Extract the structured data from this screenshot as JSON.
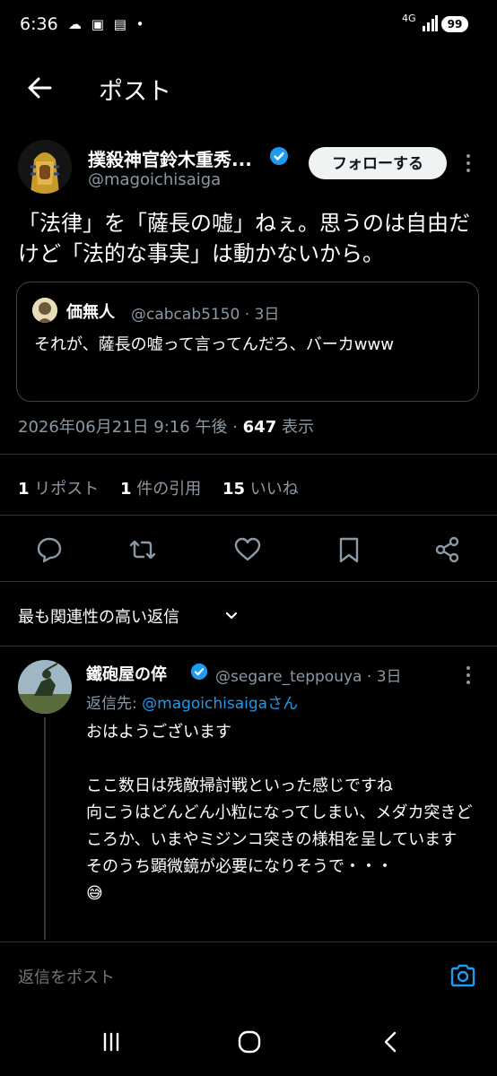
{
  "status_bar": {
    "time": "6:36",
    "icons": "☁ ▣ ▤ •",
    "network": "4G",
    "battery": "99"
  },
  "header": {
    "title": "ポスト"
  },
  "post": {
    "author_name": "撲殺神官鈴木重秀...",
    "author_handle": "@magoichisaiga",
    "follow_label": "フォローする",
    "text": "「法律」を「薩長の嘘」ねぇ。思うのは自由だけど「法的な事実」は動かないから。",
    "timestamp": "2026年06月21日 9:16 午後",
    "views_count": "647",
    "views_label": "表示",
    "quote": {
      "author_name": "価無人",
      "author_handle": "@cabcab5150",
      "time": "3日",
      "text": "それが、薩長の嘘って言ってんだろ、バーカwww"
    }
  },
  "stats": {
    "reposts_count": "1",
    "reposts_label": "リポスト",
    "quotes_count": "1",
    "quotes_label": "件の引用",
    "likes_count": "15",
    "likes_label": "いいね"
  },
  "sort": {
    "label": "最も関連性の高い返信"
  },
  "reply": {
    "author_name": "鐵砲屋の倅",
    "author_handle": "@segare_teppouya",
    "time": "3日",
    "to_prefix": "返信先: ",
    "to_mention": "@magoichisaigaさん",
    "text": "おはようございます\n\nここ数日は残敵掃討戦といった感じですね\n向こうはどんどん小粒になってしまい、メダカ突きどころか、いまやミジンコ突きの様相を呈しています\nそのうち顕微鏡が必要になりそうで・・・\n😅"
  },
  "composer": {
    "placeholder": "返信をポスト"
  },
  "colors": {
    "accent": "#1d9bf0",
    "secondary_text": "#8b98a5",
    "divider": "#2f3336"
  }
}
